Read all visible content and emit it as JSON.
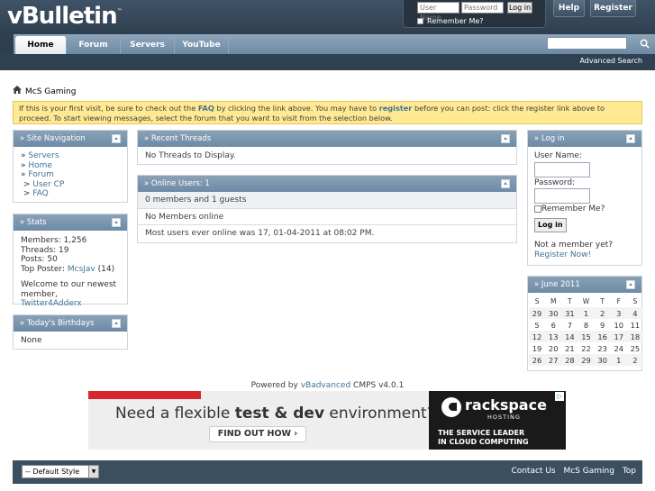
{
  "header": {
    "logo": "vBulletin",
    "logo_tm": "™",
    "username_placeholder": "User Name",
    "password_placeholder": "Password",
    "login_button": "Log in",
    "remember_me": "Remember Me?",
    "help": "Help",
    "register": "Register"
  },
  "navbar": {
    "tabs": [
      {
        "label": "Home",
        "active": true
      },
      {
        "label": "Forum"
      },
      {
        "label": "Servers"
      },
      {
        "label": "YouTube"
      }
    ],
    "search_icon": "search-icon",
    "advanced_search": "Advanced Search"
  },
  "breadcrumb": {
    "home_icon": "home-icon",
    "title": "McS Gaming"
  },
  "notice": {
    "part1": "If this is your first visit, be sure to check out the ",
    "faq": "FAQ",
    "part2": " by clicking the link above. You may have to ",
    "register": "register",
    "part3": " before you can post: click the register link above to proceed. To start viewing messages, select the forum that you want to visit from the selection below."
  },
  "site_nav": {
    "title": "» Site Navigation",
    "items": [
      {
        "prefix": "» ",
        "label": "Servers"
      },
      {
        "prefix": "» ",
        "label": "Home"
      },
      {
        "prefix": "» ",
        "label": "Forum"
      },
      {
        "prefix": " > ",
        "label": "User CP"
      },
      {
        "prefix": " > ",
        "label": "FAQ"
      }
    ]
  },
  "stats": {
    "title": "» Stats",
    "members": "Members: 1,256",
    "threads": "Threads: 19",
    "posts": "Posts: 50",
    "top_poster_label": "Top Poster: ",
    "top_poster": "McsJav",
    "top_poster_count": " (14)",
    "welcome_text": "Welcome to our newest member, ",
    "newest_member": "Twitter4Adderx"
  },
  "birthdays": {
    "title": "» Today's Birthdays",
    "body": "None"
  },
  "recent_threads": {
    "title": "» Recent Threads",
    "body": "No Threads to Display."
  },
  "online_users": {
    "title": "» Online Users: 1",
    "summary": "0 members and 1 guests",
    "members": "No Members online",
    "record": "Most users ever online was 17, 01-04-2011 at 08:02 PM."
  },
  "login_block": {
    "title": "» Log in",
    "username_label": "User Name:",
    "password_label": "Password:",
    "remember": "Remember Me?",
    "button": "Log in",
    "not_member": "Not a member yet?",
    "register_now": "Register Now!"
  },
  "calendar": {
    "title": "» June 2011",
    "days": [
      "S",
      "M",
      "T",
      "W",
      "T",
      "F",
      "S"
    ],
    "weeks": [
      [
        "29",
        "30",
        "31",
        "1",
        "2",
        "3",
        "4"
      ],
      [
        "5",
        "6",
        "7",
        "8",
        "9",
        "10",
        "11"
      ],
      [
        "12",
        "13",
        "14",
        "15",
        "16",
        "17",
        "18"
      ],
      [
        "19",
        "20",
        "21",
        "22",
        "23",
        "24",
        "25"
      ],
      [
        "26",
        "27",
        "28",
        "29",
        "30",
        "1",
        "2"
      ]
    ],
    "today": "30"
  },
  "powered": {
    "prefix": "Powered by ",
    "link": "vBadvanced",
    "suffix": " CMPS v4.0.1"
  },
  "ad": {
    "headline_a": "Need a flexible ",
    "headline_b": "test & dev",
    "headline_c": " environment?",
    "cta": "FIND OUT HOW ›",
    "brand": "rackspace",
    "brand_sub": "HOSTING",
    "tagline1": "THE SERVICE LEADER",
    "tagline2": "IN CLOUD COMPUTING",
    "adchoices": "▷"
  },
  "footer": {
    "style_select": "-- Default Style",
    "links": [
      "Contact Us",
      "McS Gaming",
      "Top"
    ]
  }
}
